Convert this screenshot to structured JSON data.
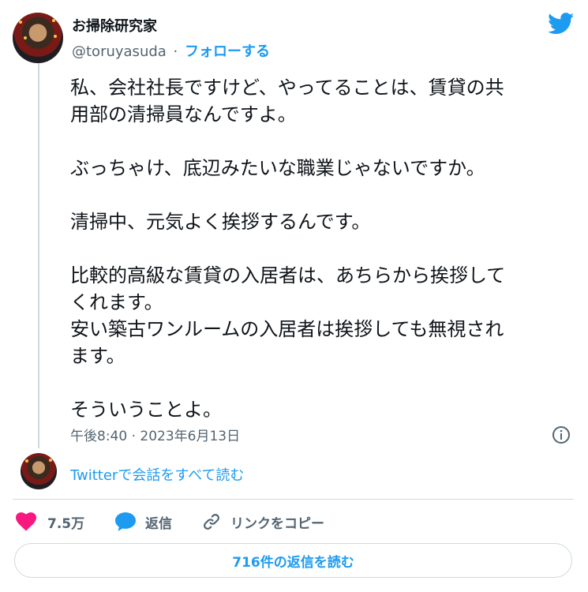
{
  "author": {
    "display_name": "お掃除研究家",
    "handle": "@toruyasuda",
    "separator": "·",
    "follow_label": "フォローする"
  },
  "tweet": {
    "paragraphs": [
      [
        "私、会社社長ですけど、やってることは、賃貸の共",
        "用部の清掃員なんですよ。"
      ],
      [
        "ぶっちゃけ、底辺みたいな職業じゃないですか。"
      ],
      [
        "清掃中、元気よく挨拶するんです。"
      ],
      [
        "比較的高級な賃貸の入居者は、あちらから挨拶して",
        "くれます。",
        "安い築古ワンルームの入居者は挨拶しても無視され",
        "ます。"
      ],
      [
        "そういうことよ。"
      ]
    ],
    "timestamp": "午後8:40 · 2023年6月13日"
  },
  "conversation": {
    "read_all_label": "Twitterで会話をすべて読む"
  },
  "actions": {
    "like_count": "7.5万",
    "reply_label": "返信",
    "copy_link_label": "リンクをコピー"
  },
  "replies_button_label": "716件の返信を読む",
  "icons": {
    "brand": "twitter-bird-icon",
    "info": "info-icon",
    "like": "heart-icon",
    "reply": "speech-bubble-icon",
    "copy": "link-icon"
  },
  "colors": {
    "accent": "#1d9bf0",
    "like": "#f91880",
    "muted": "#536471",
    "text": "#0f1419",
    "border": "#cfd9de"
  }
}
